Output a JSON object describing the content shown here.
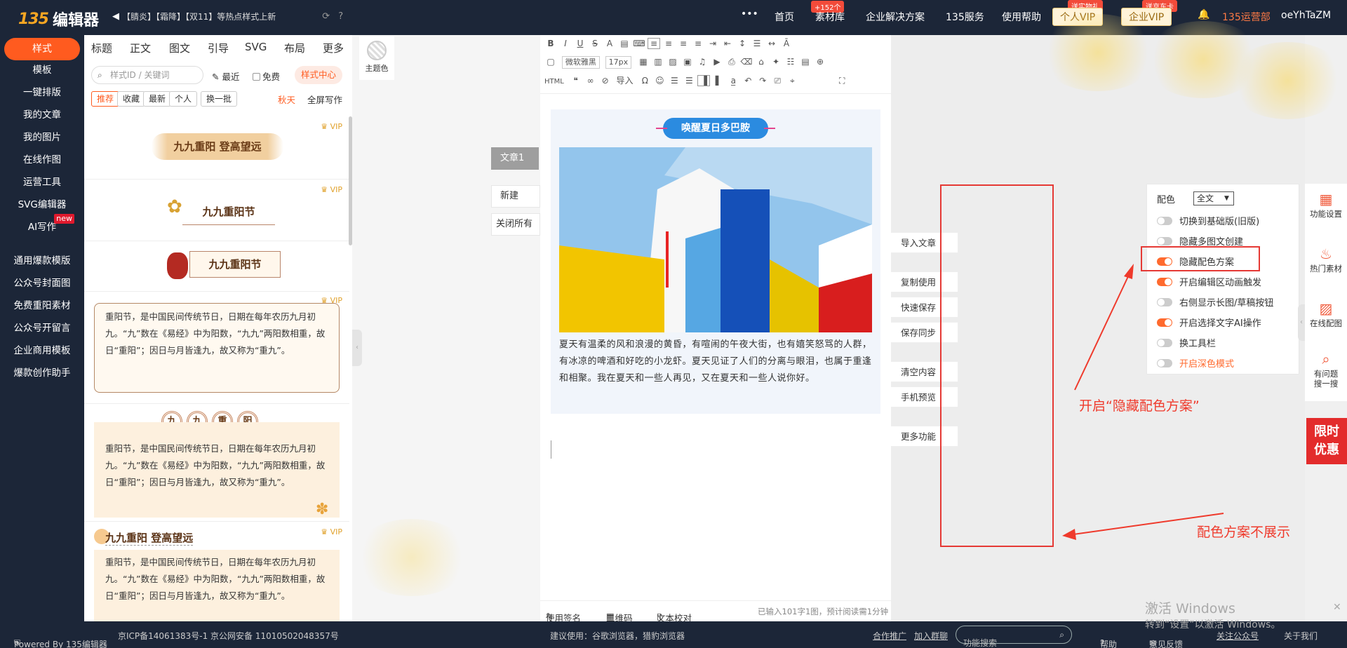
{
  "app": {
    "logo_badge": "135",
    "logo_text": "编辑器"
  },
  "announcement": "【腈炎】【霜降】【双11】等热点样式上新",
  "nav": {
    "more": "•••",
    "home": "首页",
    "materials": "素材库",
    "materials_badge": "+152个",
    "enterprise": "企业解决方案",
    "service": "135服务",
    "help": "使用帮助",
    "personal_vip": "个人VIP",
    "personal_vip_badge": "送实物礼",
    "enterprise_vip": "企业VIP",
    "enterprise_vip_badge": "送京东卡",
    "ops": "135运营部",
    "user": "oeYhTaZM"
  },
  "sidebar": {
    "items": [
      "样式",
      "模板",
      "一键排版",
      "我的文章",
      "我的图片",
      "在线作图",
      "运营工具",
      "SVG编辑器",
      "AI写作"
    ],
    "new_badge": "new",
    "section2": [
      "通用爆款模版",
      "公众号封面图",
      "免费重阳素材",
      "公众号开留言",
      "企业商用模板",
      "爆款创作助手"
    ]
  },
  "panel": {
    "tabs": [
      "标题",
      "正文",
      "图文",
      "引导",
      "SVG",
      "布局",
      "更多"
    ],
    "search_placeholder": "样式ID / 关键词",
    "recent": "最近",
    "free": "免费",
    "style_center": "样式中心",
    "filters": [
      "推荐",
      "收藏",
      "最新",
      "个人"
    ],
    "swap": "换一批",
    "season": "秋天",
    "fullscreen": "全屏写作",
    "vip": "VIP",
    "cards": {
      "c1_title": "九九重阳 登高望远",
      "c2_title": "九九重阳节",
      "c3_title": "九九重阳节",
      "c4_text": "重阳节，是中国民间传统节日，日期在每年农历九月初九。“九”数在《易经》中为阳数，“九九”两阳数相重，故日“重阳”；因日与月皆逢九，故又称为“重九”。",
      "c5_chars": [
        "九",
        "九",
        "重",
        "阳"
      ],
      "c5_text": "重阳节，是中国民间传统节日，日期在每年农历九月初九。“九”数在《易经》中为阳数，“九九”两阳数相重，故日“重阳”；因日与月皆逢九，故又称为“重九”。",
      "c6_title": "九九重阳 登高望远",
      "c6_text": "重阳节，是中国民间传统节日，日期在每年农历九月初九。“九”数在《易经》中为阳数，“九九”两阳数相重，故日“重阳”；因日与月皆逢九，故又称为“重九”。"
    }
  },
  "theme_color": "主题色",
  "articles": {
    "current": "文章1",
    "new": "新建",
    "close_all": "关闭所有"
  },
  "toolbar": {
    "font": "微软雅黑",
    "size": "17px",
    "html": "HTML",
    "import": "导入"
  },
  "content": {
    "heading": "唤醒夏日多巴胺",
    "paragraph": "夏天有温柔的风和浪漫的黄昏，有喧闹的午夜大街，也有嬉笑怒骂的人群，有冰凉的啤酒和好吃的小龙虾。夏天见证了人们的分离与眼泪，也属于重逢和相聚。我在夏天和一些人再见，又在夏天和一些人说你好。"
  },
  "editor_bottom": {
    "sign": "使用签名",
    "qrcode": "二维码",
    "proof": "文本校对",
    "stats": "已输入101字1图，预计阅读需1分钟"
  },
  "side_actions": [
    "导入文章",
    "复制使用",
    "快速保存",
    "保存同步",
    "清空内容",
    "手机预览",
    "更多功能"
  ],
  "settings": {
    "color_label": "配色",
    "color_value": "全文",
    "toggles": [
      {
        "label": "切换到基础版(旧版)",
        "on": false
      },
      {
        "label": "隐藏多图文创建",
        "on": false
      },
      {
        "label": "隐藏配色方案",
        "on": true
      },
      {
        "label": "开启编辑区动画触发",
        "on": true
      },
      {
        "label": "右侧显示长图/草稿按钮",
        "on": false
      },
      {
        "label": "开启选择文字AI操作",
        "on": true
      },
      {
        "label": "换工具栏",
        "on": false
      },
      {
        "label": "开启深色模式",
        "on": false
      }
    ]
  },
  "right_bar": [
    "功能设置",
    "热门素材",
    "在线配图",
    "有问题",
    "搜一搜"
  ],
  "promo": [
    "限时",
    "优惠"
  ],
  "annotations": {
    "note1": "开启“隐藏配色方案”",
    "note2": "配色方案不展示"
  },
  "watermark": {
    "line1": "激活 Windows",
    "line2": "转到“设置”以激活 Windows。"
  },
  "footer": {
    "powered": "Powered By 135编辑器",
    "icp": "京ICP备14061383号-1 京公网安备 11010502048357号",
    "browser": "建议使用：谷歌浏览器，猎豹浏览器",
    "partner": "合作推广",
    "group": "加入群聊",
    "search_placeholder": "功能搜索",
    "help": "帮助",
    "feedback": "意见反馈",
    "follow": "关注公众号",
    "about": "关于我们"
  },
  "colors": {
    "accent": "#ff5b1f",
    "dark": "#1c2638",
    "annotation": "#ef3a2c",
    "toggle_on": "#ff6a2e"
  }
}
